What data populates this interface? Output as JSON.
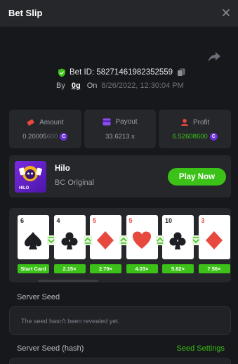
{
  "header": {
    "title": "Bet Slip",
    "close_icon": "close-icon"
  },
  "share_icon": "share-icon",
  "bet": {
    "id_text": "Bet ID: 58271461982352559",
    "by_label": "By",
    "user": "0g",
    "on_label": "On",
    "date": "8/26/2022, 12:30:04 PM"
  },
  "stats": {
    "amount": {
      "label": "Amount",
      "value_main": "0.20005",
      "value_dim": "600",
      "icon": "amount-icon"
    },
    "payout": {
      "label": "Payout",
      "value": "33.6213 x",
      "icon": "payout-icon"
    },
    "profit": {
      "label": "Profit",
      "value": "6.52608600",
      "icon": "profit-icon"
    },
    "coin_symbol": "C"
  },
  "game": {
    "name": "Hilo",
    "provider": "BC Original",
    "play_label": "Play Now",
    "thumb_text": "HILO"
  },
  "cards": [
    {
      "rank": "6",
      "suit": "spade",
      "color": "black",
      "label": "Start Card"
    },
    {
      "rank": "4",
      "suit": "club",
      "color": "black",
      "label": "2.15×",
      "arrow": "down"
    },
    {
      "rank": "5",
      "suit": "diamond",
      "color": "red",
      "label": "2.79×",
      "arrow": "up"
    },
    {
      "rank": "5",
      "suit": "heart",
      "color": "red",
      "label": "4.03×",
      "arrow": "up"
    },
    {
      "rank": "10",
      "suit": "club",
      "color": "black",
      "label": "5.82×",
      "arrow": "up"
    },
    {
      "rank": "3",
      "suit": "diamond",
      "color": "red",
      "label": "7.56×",
      "arrow": "down"
    }
  ],
  "server_seed": {
    "label": "Server Seed",
    "value": "The seed hasn't been revealed yet.",
    "hash_label": "Server Seed (hash)",
    "settings_link": "Seed Settings"
  },
  "colors": {
    "accent_green": "#3bc117",
    "coin_purple": "#6b2fd6",
    "panel": "#25272b",
    "bg": "#17181b"
  }
}
